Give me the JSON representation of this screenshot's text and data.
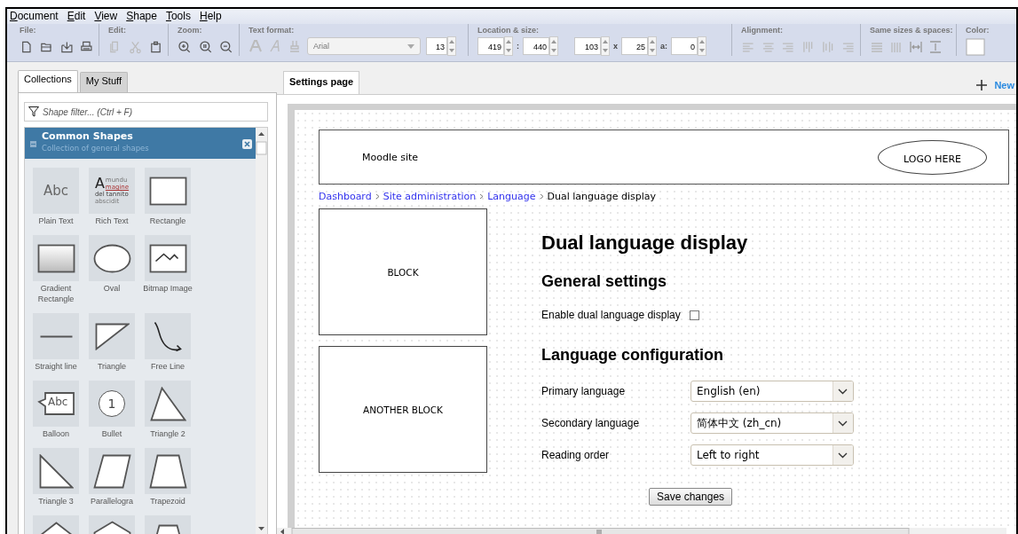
{
  "menu": [
    "Document",
    "Edit",
    "View",
    "Shape",
    "Tools",
    "Help"
  ],
  "toolbar": [
    {
      "kind": "file",
      "label": "File:"
    },
    {
      "kind": "edit",
      "label": "Edit:"
    },
    {
      "kind": "zoom",
      "label": "Zoom:"
    },
    {
      "kind": "text_format",
      "label": "Text format:",
      "fields": [
        {
          "kind": "select",
          "value": "Arial"
        },
        {
          "kind": "spin",
          "value": "13"
        }
      ]
    },
    {
      "kind": "location",
      "label": "Location & size:",
      "fields": [
        {
          "kind": "spin",
          "value": "419"
        },
        {
          "kind": "sep",
          "text": ":"
        },
        {
          "kind": "spin",
          "value": "440"
        },
        {
          "kind": "gap"
        },
        {
          "kind": "spin",
          "value": "103"
        },
        {
          "kind": "sep",
          "text": "x"
        },
        {
          "kind": "spin",
          "value": "25"
        },
        {
          "kind": "sep",
          "text": "a:"
        },
        {
          "kind": "spin",
          "value": "0"
        }
      ]
    },
    {
      "kind": "alignment",
      "label": "Alignment:"
    },
    {
      "kind": "same_sizes",
      "label": "Same sizes & spaces:"
    },
    {
      "kind": "color",
      "label": "Color:"
    }
  ],
  "side_tabs": [
    {
      "label": "Collections",
      "selected": true
    },
    {
      "label": "My Stuff",
      "selected": false
    }
  ],
  "filter": {
    "placeholder": "Shape filter... (Ctrl + F)"
  },
  "library": {
    "title": "Common Shapes",
    "subtitle": "Collection of general shapes",
    "expanded": true,
    "shapes": [
      {
        "kind": "plain_text",
        "label": "Plain Text",
        "sample": "Abc"
      },
      {
        "kind": "rich_text",
        "label": "Rich Text",
        "sample": "A",
        "lines": [
          "mundu",
          "magine",
          "del tannito",
          "abscidit"
        ]
      },
      {
        "kind": "rectangle",
        "label": "Rectangle"
      },
      {
        "kind": "gradient_rectangle",
        "label": "Gradient Rectangle"
      },
      {
        "kind": "oval",
        "label": "Oval"
      },
      {
        "kind": "bitmap",
        "label": "Bitmap Image"
      },
      {
        "kind": "line",
        "label": "Straight line"
      },
      {
        "kind": "triangle",
        "label": "Triangle"
      },
      {
        "kind": "free_line",
        "label": "Free Line"
      },
      {
        "kind": "balloon",
        "label": "Balloon",
        "sample": "Abc"
      },
      {
        "kind": "bullet",
        "label": "Bullet",
        "sample": "1"
      },
      {
        "kind": "triangle2",
        "label": "Triangle 2"
      },
      {
        "kind": "triangle3",
        "label": "Triangle 3"
      },
      {
        "kind": "parallelogram",
        "label": "Parallelogra"
      },
      {
        "kind": "trapezoid",
        "label": "Trapezoid"
      },
      {
        "kind": "pentagon"
      },
      {
        "kind": "hexagon"
      },
      {
        "kind": "trapezoid_top"
      }
    ]
  },
  "doc_tabs": [
    {
      "label": "Settings page",
      "selected": true
    }
  ],
  "new_button": {
    "label": "New"
  },
  "mockup": {
    "header": {
      "site_name": "Moodle site",
      "logo": "LOGO HERE"
    },
    "breadcrumb": [
      {
        "label": "Dashboard",
        "link": true
      },
      {
        "label": "Site administration",
        "link": true
      },
      {
        "label": "Language",
        "link": true
      },
      {
        "label": "Dual language display",
        "link": false
      }
    ],
    "blocks": [
      "BLOCK",
      "ANOTHER BLOCK"
    ],
    "title": "Dual language display",
    "general_heading": "General settings",
    "checkbox": {
      "label": "Enable dual language display",
      "checked": false
    },
    "config_heading": "Language configuration",
    "selects": [
      {
        "label": "Primary language",
        "value": "English (en)"
      },
      {
        "label": "Secondary language",
        "value": "简体中文 (zh_cn)"
      },
      {
        "label": "Reading order",
        "value": "Left to right"
      }
    ],
    "save_button": "Save changes"
  }
}
